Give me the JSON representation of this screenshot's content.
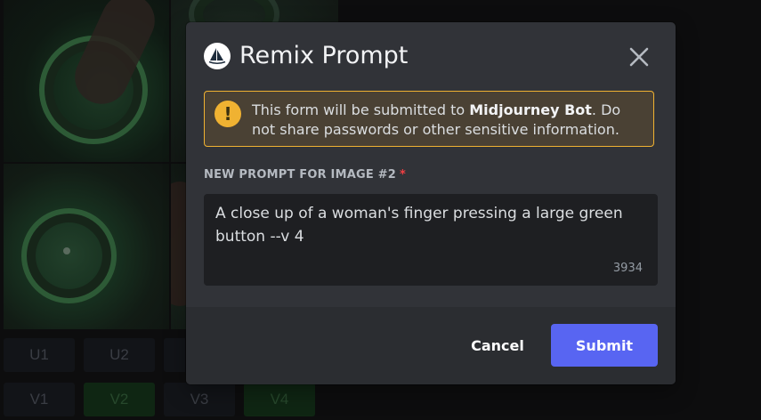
{
  "background": {
    "upscale_buttons": [
      "U1",
      "U2"
    ],
    "variation_buttons": [
      "V1",
      "V2",
      "V3",
      "V4"
    ]
  },
  "modal": {
    "title": "Remix Prompt",
    "avatar_icon": "midjourney-sailboat-icon",
    "close_icon": "close-icon",
    "notice": {
      "prefix": "This form will be submitted to ",
      "bot_name": "Midjourney Bot",
      "suffix": ". Do not share passwords or other sensitive information.",
      "icon": "warning-icon"
    },
    "field": {
      "label": "NEW PROMPT FOR IMAGE #2",
      "required_mark": "*",
      "value": "A close up of a woman's finger pressing a large green button --v 4",
      "remaining_chars": "3934"
    },
    "buttons": {
      "cancel": "Cancel",
      "submit": "Submit"
    }
  },
  "colors": {
    "modal_bg": "#313338",
    "footer_bg": "#2b2d31",
    "input_bg": "#1e1f22",
    "warning_border": "#f0b232",
    "required": "#f23f43",
    "primary": "#5865f2"
  }
}
